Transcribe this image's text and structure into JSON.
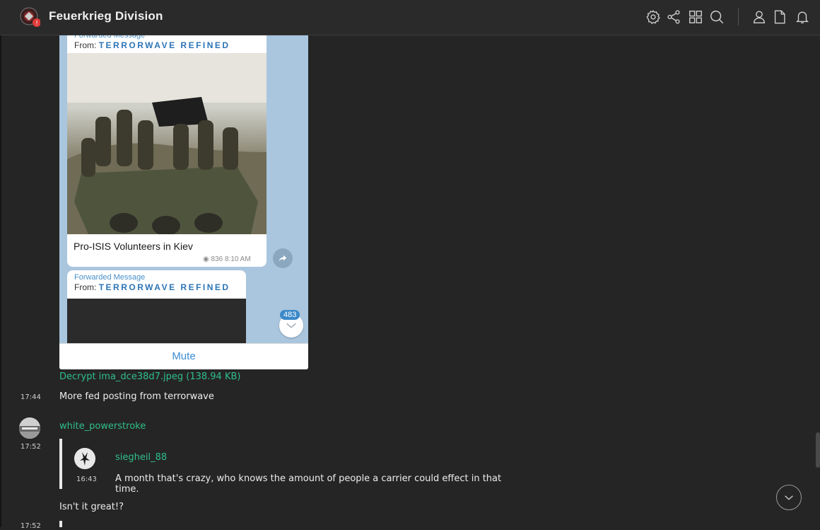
{
  "header": {
    "title": "Feuerkrieg Division",
    "logo_badge": "!",
    "icons": [
      "settings-icon",
      "share-icon",
      "grid-icon",
      "search-icon",
      "user-icon",
      "file-icon",
      "bell-icon"
    ]
  },
  "embedded_screenshot": {
    "forward_label": "Forwarded Message",
    "forward_from_prefix": "From:",
    "forward_from": "TERRORWAVE REFINED",
    "caption": "Pro-ISIS Volunteers in Kiev",
    "views_time": "836 8:10 AM",
    "unread_badge": "483",
    "mute_label": "Mute"
  },
  "messages": [
    {
      "attachment_link": "Decrypt ima_dce38d7.jpeg (138.94 KB)",
      "time": "17:44",
      "text": "More fed posting from terrorwave"
    },
    {
      "author": "white_powerstroke",
      "time": "17:52",
      "quote": {
        "author": "siegheil_88",
        "time": "16:43",
        "text": "A month that's crazy, who knows the amount of people a carrier could effect in that time."
      },
      "text": "Isn't it great!?"
    },
    {
      "time": "17:52"
    }
  ],
  "colors": {
    "link": "#2fbf8a",
    "background": "#252525",
    "header": "#2a2a2a"
  }
}
